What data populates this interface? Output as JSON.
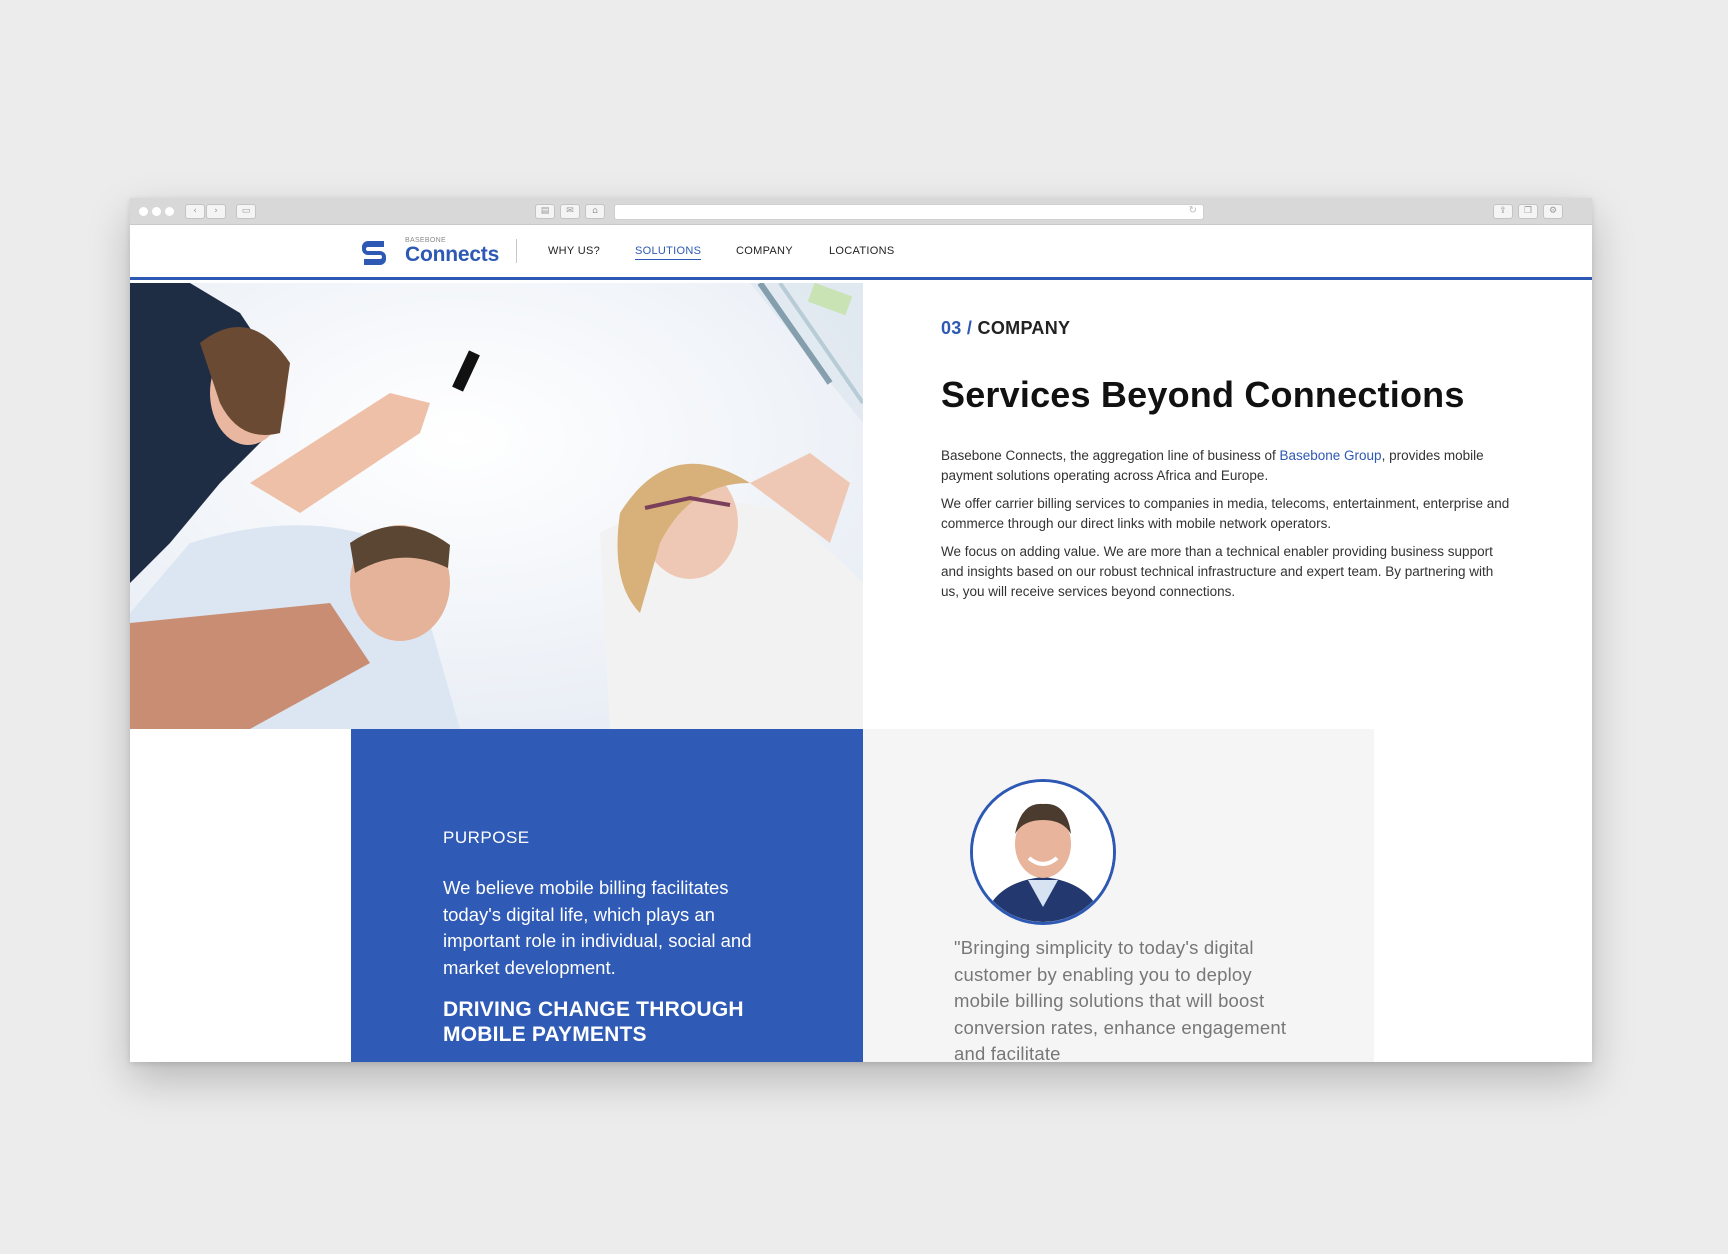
{
  "browser": {
    "url": "",
    "icons": {
      "back": "chevron-left-icon",
      "forward": "chevron-right-icon",
      "sidebar": "sidebar-icon",
      "print": "print-icon",
      "mail": "mail-icon",
      "home": "home-icon",
      "reload": "reload-icon",
      "share": "share-icon",
      "tabs": "tabs-icon",
      "settings": "gear-icon"
    }
  },
  "brand": {
    "small": "BASEBONE",
    "name": "Connects",
    "color": "#2d58b4"
  },
  "nav": {
    "items": [
      {
        "label": "WHY US?"
      },
      {
        "label": "SOLUTIONS"
      },
      {
        "label": "COMPANY"
      },
      {
        "label": "LOCATIONS"
      }
    ]
  },
  "hero": {
    "eyebrow_num": "03 /",
    "eyebrow_label": "COMPANY",
    "headline": "Services Beyond Connections",
    "p1_before": "Basebone Connects, the aggregation line of business of ",
    "p1_link": "Basebone Group",
    "p1_after": ", provides mobile payment solutions operating across Africa and Europe.",
    "p2": "We offer carrier billing services to companies in media, telecoms, entertainment, enterprise and commerce through our direct links with mobile network operators.",
    "p3": "We focus on adding value. We are more than a technical enabler providing business support and insights based on our robust technical infrastructure and expert team. By partnering with us, you will receive services beyond connections."
  },
  "purpose": {
    "label": "PURPOSE",
    "text": "We believe mobile billing facilitates today's digital life, which plays an important role in individual, social and market development.",
    "headline": "DRIVING CHANGE THROUGH MOBILE PAYMENTS",
    "color": "#2f5ab5"
  },
  "quote": {
    "text": "\"Bringing simplicity to today's digital customer by enabling you to deploy mobile billing solutions that will boost conversion rates, enhance engagement and facilitate"
  }
}
